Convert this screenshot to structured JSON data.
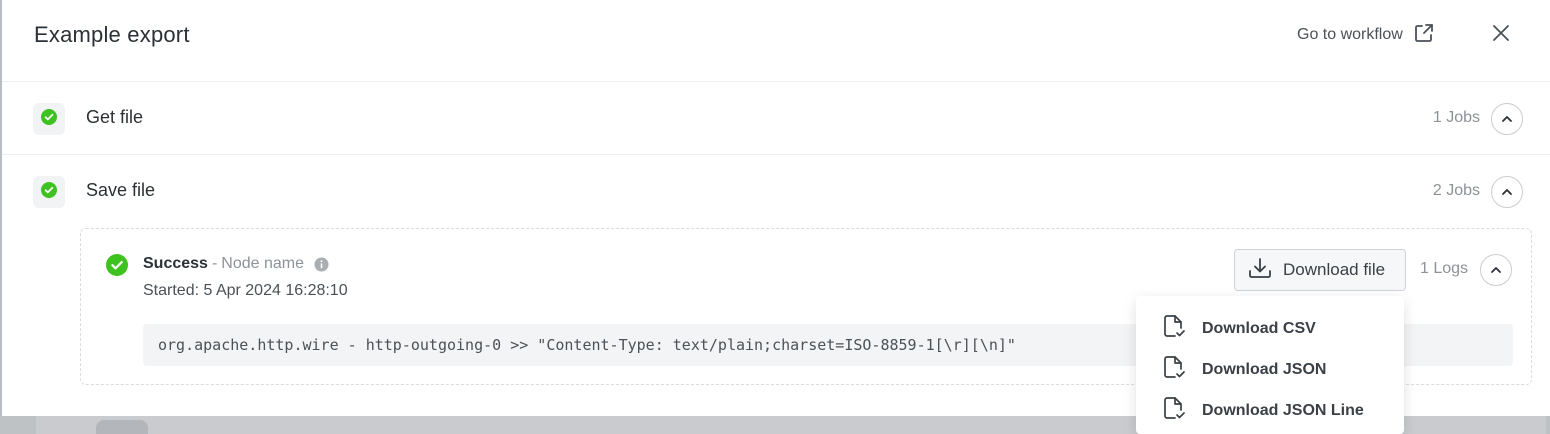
{
  "header": {
    "title": "Example export",
    "goto_label": "Go to workflow"
  },
  "steps": [
    {
      "name": "Get file",
      "jobs": "1 Jobs",
      "status": "success"
    },
    {
      "name": "Save file",
      "jobs": "2 Jobs",
      "status": "success"
    }
  ],
  "job": {
    "status": "Success",
    "separator": "-",
    "node_name": "Node name",
    "started": "Started: 5 Apr 2024 16:28:10",
    "download_label": "Download file",
    "logs": "1 Logs",
    "log_line": "org.apache.http.wire - http-outgoing-0 >> \"Content-Type: text/plain;charset=ISO-8859-1[\\r][\\n]\""
  },
  "download_menu": {
    "items": [
      {
        "label": "Download CSV"
      },
      {
        "label": "Download JSON"
      },
      {
        "label": "Download JSON Line"
      }
    ]
  },
  "colors": {
    "success": "#3ec21f",
    "text": "#2b3136",
    "muted": "#8c9298"
  },
  "icons": {
    "goto": "external-link-icon",
    "close": "close-icon",
    "status": "check-circle-icon",
    "chevron": "chevron-up-icon",
    "info": "info-icon",
    "download": "download-icon",
    "copy": "copy-icon",
    "file": "file-check-icon"
  }
}
